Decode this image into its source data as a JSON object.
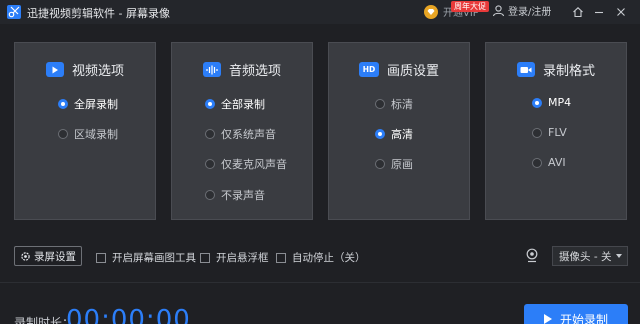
{
  "titlebar": {
    "app_title": "迅捷视频剪辑软件 - 屏幕录像",
    "vip_text": "开通VIP",
    "vip_badge": "周年大促",
    "login": "登录/注册"
  },
  "cards": {
    "video": {
      "title": "视频选项",
      "options": [
        "全屏录制",
        "区域录制"
      ],
      "selected": "全屏录制"
    },
    "audio": {
      "title": "音频选项",
      "options": [
        "全部录制",
        "仅系统声音",
        "仅麦克风声音",
        "不录声音"
      ],
      "selected": "全部录制"
    },
    "quality": {
      "title": "画质设置",
      "icon_text": "HD",
      "options": [
        "标清",
        "高清",
        "原画"
      ],
      "selected": "高清"
    },
    "format": {
      "title": "录制格式",
      "options": [
        "MP4",
        "FLV",
        "AVI"
      ],
      "selected": "MP4"
    }
  },
  "toolbar": {
    "settings_label": "录屏设置",
    "draw_tool": "开启屏幕画图工具",
    "float_frame": "开启悬浮框",
    "auto_stop": "自动停止（关）",
    "camera_select": "摄像头 - 关"
  },
  "footer": {
    "duration_label": "录制时长：",
    "duration_value": "00:00:00",
    "start_label": "开始录制"
  },
  "colors": {
    "accent": "#2c7ef8",
    "background": "#1f2024",
    "card": "#3a3c41",
    "vip_badge": "#e83a3a"
  }
}
